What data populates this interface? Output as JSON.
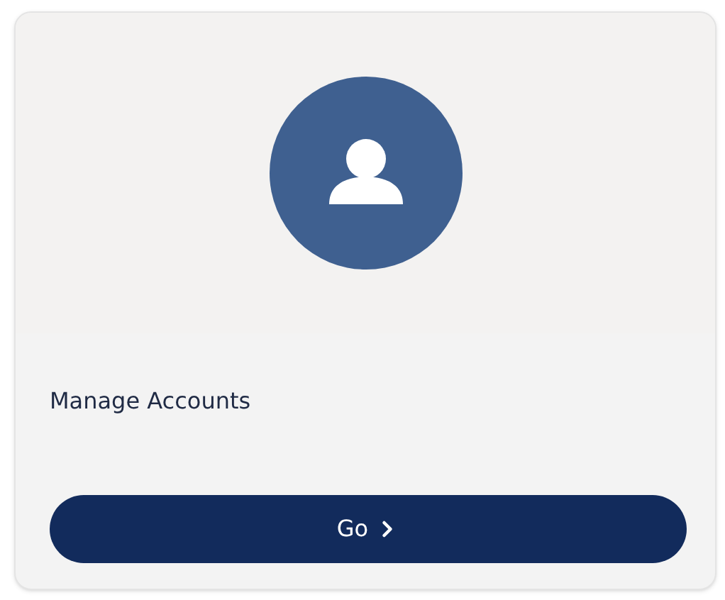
{
  "card": {
    "title": "Manage Accounts",
    "button": {
      "label": "Go"
    }
  }
}
